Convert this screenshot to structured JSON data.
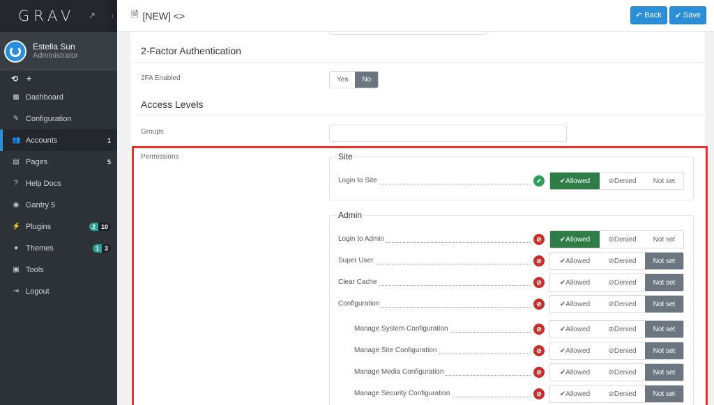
{
  "sidebar": {
    "logo": "GRAV",
    "user": {
      "name": "Estella Sun",
      "role": "Administrator"
    },
    "quick_icons": [
      "⟲",
      "+"
    ],
    "items": [
      {
        "label": "Dashboard",
        "icon": "grid-icon",
        "glyph": "▦",
        "count": ""
      },
      {
        "label": "Configuration",
        "icon": "wrench-icon",
        "glyph": "✎",
        "count": ""
      },
      {
        "label": "Accounts",
        "icon": "users-icon",
        "glyph": "👥",
        "count": "1",
        "active": true
      },
      {
        "label": "Pages",
        "icon": "file-icon",
        "glyph": "▤",
        "count": "5"
      },
      {
        "label": "Help Docs",
        "icon": "help-icon",
        "glyph": "?",
        "count": ""
      },
      {
        "label": "Gantry 5",
        "icon": "gantry-icon",
        "glyph": "◉",
        "count": ""
      },
      {
        "label": "Plugins",
        "icon": "plug-icon",
        "glyph": "⚡",
        "badge_green": "2",
        "badge_dark": "10"
      },
      {
        "label": "Themes",
        "icon": "drop-icon",
        "glyph": "●",
        "badge_green": "1",
        "badge_dark": "3"
      },
      {
        "label": "Tools",
        "icon": "briefcase-icon",
        "glyph": "▣",
        "count": ""
      },
      {
        "label": "Logout",
        "icon": "logout-icon",
        "glyph": "⇥",
        "count": ""
      }
    ]
  },
  "header": {
    "title": "[NEW] <>",
    "back_label": "Back",
    "save_label": "Save"
  },
  "form": {
    "two_factor_title": "2-Factor Authentication",
    "twofa_label": "2FA Enabled",
    "yes_label": "Yes",
    "no_label": "No",
    "access_title": "Access Levels",
    "groups_label": "Groups",
    "permissions_label": "Permissions"
  },
  "permissions": {
    "site": {
      "legend": "Site",
      "rows": [
        {
          "label": "Login to Site",
          "status": "ok",
          "selected": "allowed"
        }
      ]
    },
    "admin": {
      "legend": "Admin",
      "rows": [
        {
          "label": "Login to Admin",
          "status": "deny",
          "selected": "allowed",
          "indent": false
        },
        {
          "label": "Super User",
          "status": "deny",
          "selected": "notset",
          "indent": false
        },
        {
          "label": "Clear Cache",
          "status": "deny",
          "selected": "notset",
          "indent": false
        },
        {
          "label": "Configuration",
          "status": "deny",
          "selected": "notset",
          "indent": false
        },
        {
          "label": "Manage System Configuration",
          "status": "deny",
          "selected": "notset",
          "indent": true
        },
        {
          "label": "Manage Site Configuration",
          "status": "deny",
          "selected": "notset",
          "indent": true
        },
        {
          "label": "Manage Media Configuration",
          "status": "deny",
          "selected": "notset",
          "indent": true
        },
        {
          "label": "Manage Security Configuration",
          "status": "deny",
          "selected": "notset",
          "indent": true
        }
      ]
    },
    "option_labels": {
      "allowed": "Allowed",
      "denied": "Denied",
      "notset": "Not set"
    }
  }
}
